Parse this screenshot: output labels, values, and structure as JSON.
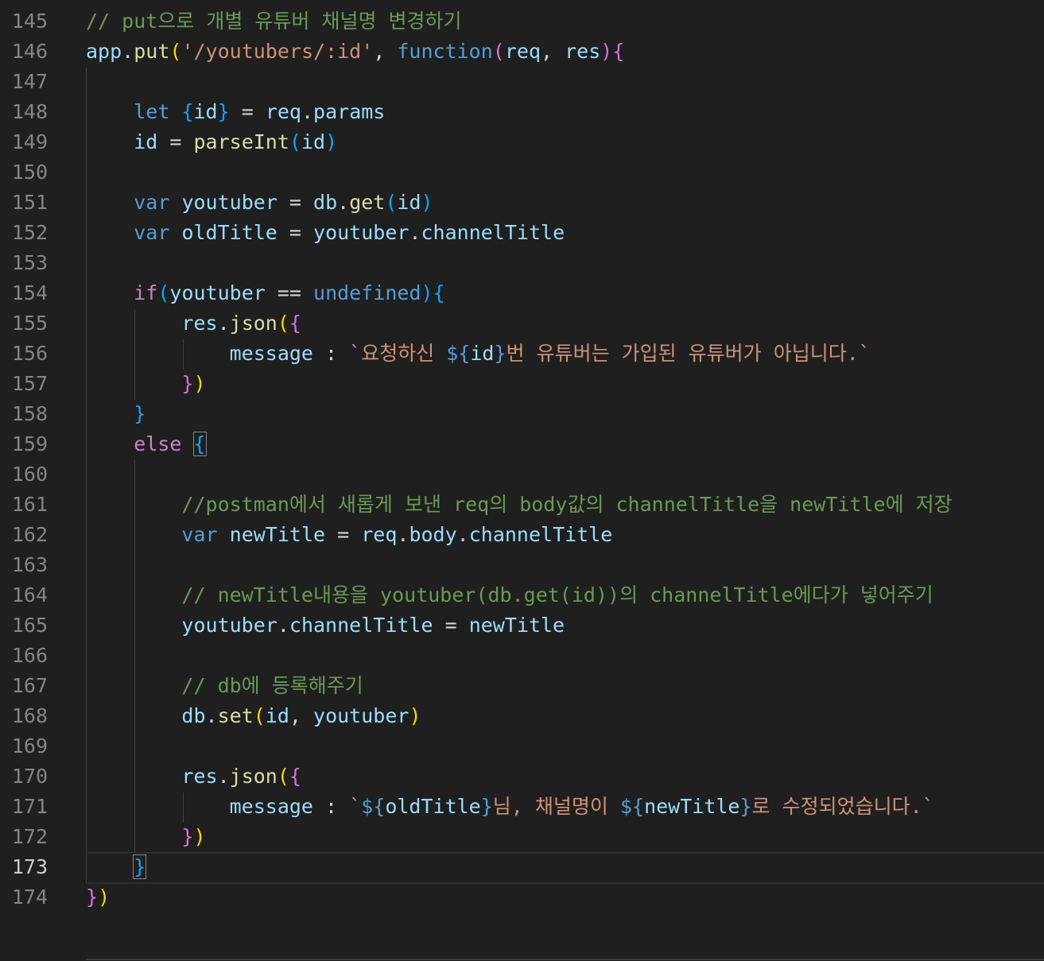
{
  "editor": {
    "active_line": 173,
    "lines": [
      {
        "n": 145,
        "tokens": [
          [
            "// put으로 개별 유튜버 채널명 변경하기",
            "cm"
          ]
        ]
      },
      {
        "n": 146,
        "tokens": [
          [
            "app",
            "v"
          ],
          [
            ".",
            "op"
          ],
          [
            "put",
            "fn"
          ],
          [
            "(",
            "b1"
          ],
          [
            "'/youtubers/:id'",
            "str"
          ],
          [
            ", ",
            "op"
          ],
          [
            "function",
            "kw"
          ],
          [
            "(",
            "b2"
          ],
          [
            "req",
            "v"
          ],
          [
            ", ",
            "op"
          ],
          [
            "res",
            "v"
          ],
          [
            ")",
            "b2"
          ],
          [
            "{",
            "b2"
          ]
        ]
      },
      {
        "n": 147,
        "tokens": []
      },
      {
        "n": 148,
        "tokens": [
          [
            "    ",
            "op"
          ],
          [
            "let",
            "kw"
          ],
          [
            " ",
            "op"
          ],
          [
            "{",
            "b3"
          ],
          [
            "id",
            "v"
          ],
          [
            "}",
            "b3"
          ],
          [
            " = ",
            "op"
          ],
          [
            "req",
            "v"
          ],
          [
            ".",
            "op"
          ],
          [
            "params",
            "v"
          ]
        ]
      },
      {
        "n": 149,
        "tokens": [
          [
            "    ",
            "op"
          ],
          [
            "id",
            "v"
          ],
          [
            " = ",
            "op"
          ],
          [
            "parseInt",
            "fn"
          ],
          [
            "(",
            "b3"
          ],
          [
            "id",
            "v"
          ],
          [
            ")",
            "b3"
          ]
        ]
      },
      {
        "n": 150,
        "tokens": []
      },
      {
        "n": 151,
        "tokens": [
          [
            "    ",
            "op"
          ],
          [
            "var",
            "kw"
          ],
          [
            " ",
            "op"
          ],
          [
            "youtuber",
            "v"
          ],
          [
            " = ",
            "op"
          ],
          [
            "db",
            "v"
          ],
          [
            ".",
            "op"
          ],
          [
            "get",
            "fn"
          ],
          [
            "(",
            "b3"
          ],
          [
            "id",
            "v"
          ],
          [
            ")",
            "b3"
          ]
        ]
      },
      {
        "n": 152,
        "tokens": [
          [
            "    ",
            "op"
          ],
          [
            "var",
            "kw"
          ],
          [
            " ",
            "op"
          ],
          [
            "oldTitle",
            "v"
          ],
          [
            " = ",
            "op"
          ],
          [
            "youtuber",
            "v"
          ],
          [
            ".",
            "op"
          ],
          [
            "channelTitle",
            "v"
          ]
        ]
      },
      {
        "n": 153,
        "tokens": []
      },
      {
        "n": 154,
        "tokens": [
          [
            "    ",
            "op"
          ],
          [
            "if",
            "ctl"
          ],
          [
            "(",
            "b3"
          ],
          [
            "youtuber",
            "v"
          ],
          [
            " == ",
            "op"
          ],
          [
            "undefined",
            "kw"
          ],
          [
            ")",
            "b3"
          ],
          [
            "{",
            "b3"
          ]
        ]
      },
      {
        "n": 155,
        "tokens": [
          [
            "        ",
            "op"
          ],
          [
            "res",
            "v"
          ],
          [
            ".",
            "op"
          ],
          [
            "json",
            "fn"
          ],
          [
            "(",
            "b1"
          ],
          [
            "{",
            "b2"
          ]
        ]
      },
      {
        "n": 156,
        "tokens": [
          [
            "            ",
            "op"
          ],
          [
            "message",
            "v"
          ],
          [
            " : ",
            "op"
          ],
          [
            "`요청하신 ",
            "str"
          ],
          [
            "${",
            "tpl"
          ],
          [
            "id",
            "v"
          ],
          [
            "}",
            "tpl"
          ],
          [
            "번 유튜버는 가입된 유튜버가 아닙니다.`",
            "str"
          ]
        ]
      },
      {
        "n": 157,
        "tokens": [
          [
            "        ",
            "op"
          ],
          [
            "}",
            "b2"
          ],
          [
            ")",
            "b1"
          ]
        ]
      },
      {
        "n": 158,
        "tokens": [
          [
            "    ",
            "op"
          ],
          [
            "}",
            "b3"
          ]
        ]
      },
      {
        "n": 159,
        "tokens": [
          [
            "    ",
            "op"
          ],
          [
            "else",
            "ctl"
          ],
          [
            " ",
            "op"
          ],
          [
            "{",
            "b3 match"
          ]
        ]
      },
      {
        "n": 160,
        "tokens": []
      },
      {
        "n": 161,
        "tokens": [
          [
            "        ",
            "op"
          ],
          [
            "//postman에서 새롭게 보낸 req의 body값의 channelTitle을 newTitle에 저장",
            "cm"
          ]
        ]
      },
      {
        "n": 162,
        "tokens": [
          [
            "        ",
            "op"
          ],
          [
            "var",
            "kw"
          ],
          [
            " ",
            "op"
          ],
          [
            "newTitle",
            "v"
          ],
          [
            " = ",
            "op"
          ],
          [
            "req",
            "v"
          ],
          [
            ".",
            "op"
          ],
          [
            "body",
            "v"
          ],
          [
            ".",
            "op"
          ],
          [
            "channelTitle",
            "v"
          ]
        ]
      },
      {
        "n": 163,
        "tokens": []
      },
      {
        "n": 164,
        "tokens": [
          [
            "        ",
            "op"
          ],
          [
            "// newTitle내용을 youtuber(db.get(id))의 channelTitle에다가 넣어주기",
            "cm"
          ]
        ]
      },
      {
        "n": 165,
        "tokens": [
          [
            "        ",
            "op"
          ],
          [
            "youtuber",
            "v"
          ],
          [
            ".",
            "op"
          ],
          [
            "channelTitle",
            "v"
          ],
          [
            " = ",
            "op"
          ],
          [
            "newTitle",
            "v"
          ]
        ]
      },
      {
        "n": 166,
        "tokens": []
      },
      {
        "n": 167,
        "tokens": [
          [
            "        ",
            "op"
          ],
          [
            "// db에 등록해주기",
            "cm"
          ]
        ]
      },
      {
        "n": 168,
        "tokens": [
          [
            "        ",
            "op"
          ],
          [
            "db",
            "v"
          ],
          [
            ".",
            "op"
          ],
          [
            "set",
            "fn"
          ],
          [
            "(",
            "b1"
          ],
          [
            "id",
            "v"
          ],
          [
            ", ",
            "op"
          ],
          [
            "youtuber",
            "v"
          ],
          [
            ")",
            "b1"
          ]
        ]
      },
      {
        "n": 169,
        "tokens": []
      },
      {
        "n": 170,
        "tokens": [
          [
            "        ",
            "op"
          ],
          [
            "res",
            "v"
          ],
          [
            ".",
            "op"
          ],
          [
            "json",
            "fn"
          ],
          [
            "(",
            "b1"
          ],
          [
            "{",
            "b2"
          ]
        ]
      },
      {
        "n": 171,
        "tokens": [
          [
            "            ",
            "op"
          ],
          [
            "message",
            "v"
          ],
          [
            " : ",
            "op"
          ],
          [
            "`",
            "str"
          ],
          [
            "${",
            "tpl"
          ],
          [
            "oldTitle",
            "v"
          ],
          [
            "}",
            "tpl"
          ],
          [
            "님, 채널명이 ",
            "str"
          ],
          [
            "${",
            "tpl"
          ],
          [
            "newTitle",
            "v"
          ],
          [
            "}",
            "tpl"
          ],
          [
            "로 수정되었습니다.`",
            "str"
          ]
        ]
      },
      {
        "n": 172,
        "tokens": [
          [
            "        ",
            "op"
          ],
          [
            "}",
            "b2"
          ],
          [
            ")",
            "b1"
          ]
        ]
      },
      {
        "n": 173,
        "tokens": [
          [
            "    ",
            "op"
          ],
          [
            "}",
            "b3 match"
          ]
        ]
      },
      {
        "n": 174,
        "tokens": [
          [
            "}",
            "b2"
          ],
          [
            ")",
            "b1"
          ]
        ]
      }
    ]
  }
}
